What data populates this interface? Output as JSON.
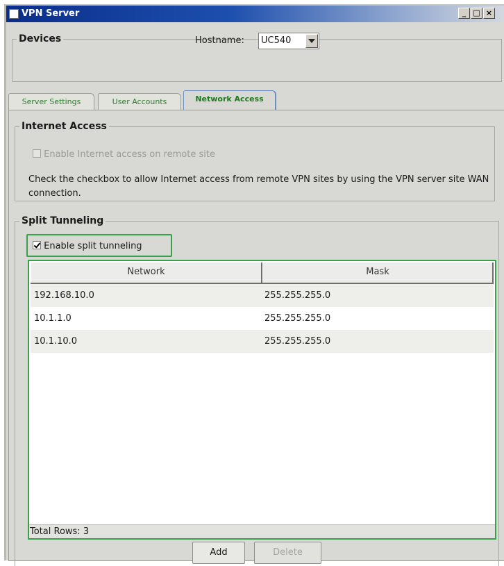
{
  "window": {
    "title": "VPN Server",
    "minimize": "_",
    "restore": "□",
    "close": "×"
  },
  "devices": {
    "legend": "Devices",
    "hostname_label": "Hostname:",
    "hostname_value": "UC540"
  },
  "tabs": [
    {
      "label": "Server Settings",
      "active": false
    },
    {
      "label": "User Accounts",
      "active": false
    },
    {
      "label": "Network Access",
      "active": true
    }
  ],
  "internet_access": {
    "legend": "Internet Access",
    "checkbox_label": "Enable Internet access on remote site",
    "checked": false,
    "disabled": true,
    "help_text": "Check the checkbox to allow Internet access from remote VPN sites by using the VPN server site WAN connection."
  },
  "split_tunneling": {
    "legend": "Split Tunneling",
    "checkbox_label": "Enable split tunneling",
    "checked": true,
    "columns": [
      "Network",
      "Mask"
    ],
    "rows": [
      {
        "network": "192.168.10.0",
        "mask": "255.255.255.0"
      },
      {
        "network": "10.1.1.0",
        "mask": "255.255.255.0"
      },
      {
        "network": "10.1.10.0",
        "mask": "255.255.255.0"
      }
    ],
    "total_rows": "Total Rows: 3"
  },
  "buttons": {
    "add": "Add",
    "delete": "Delete"
  },
  "colors": {
    "focus_green": "#39a04a",
    "tab_text_green": "#2f7a2f",
    "titlebar_blue": "#0a2e8a"
  }
}
